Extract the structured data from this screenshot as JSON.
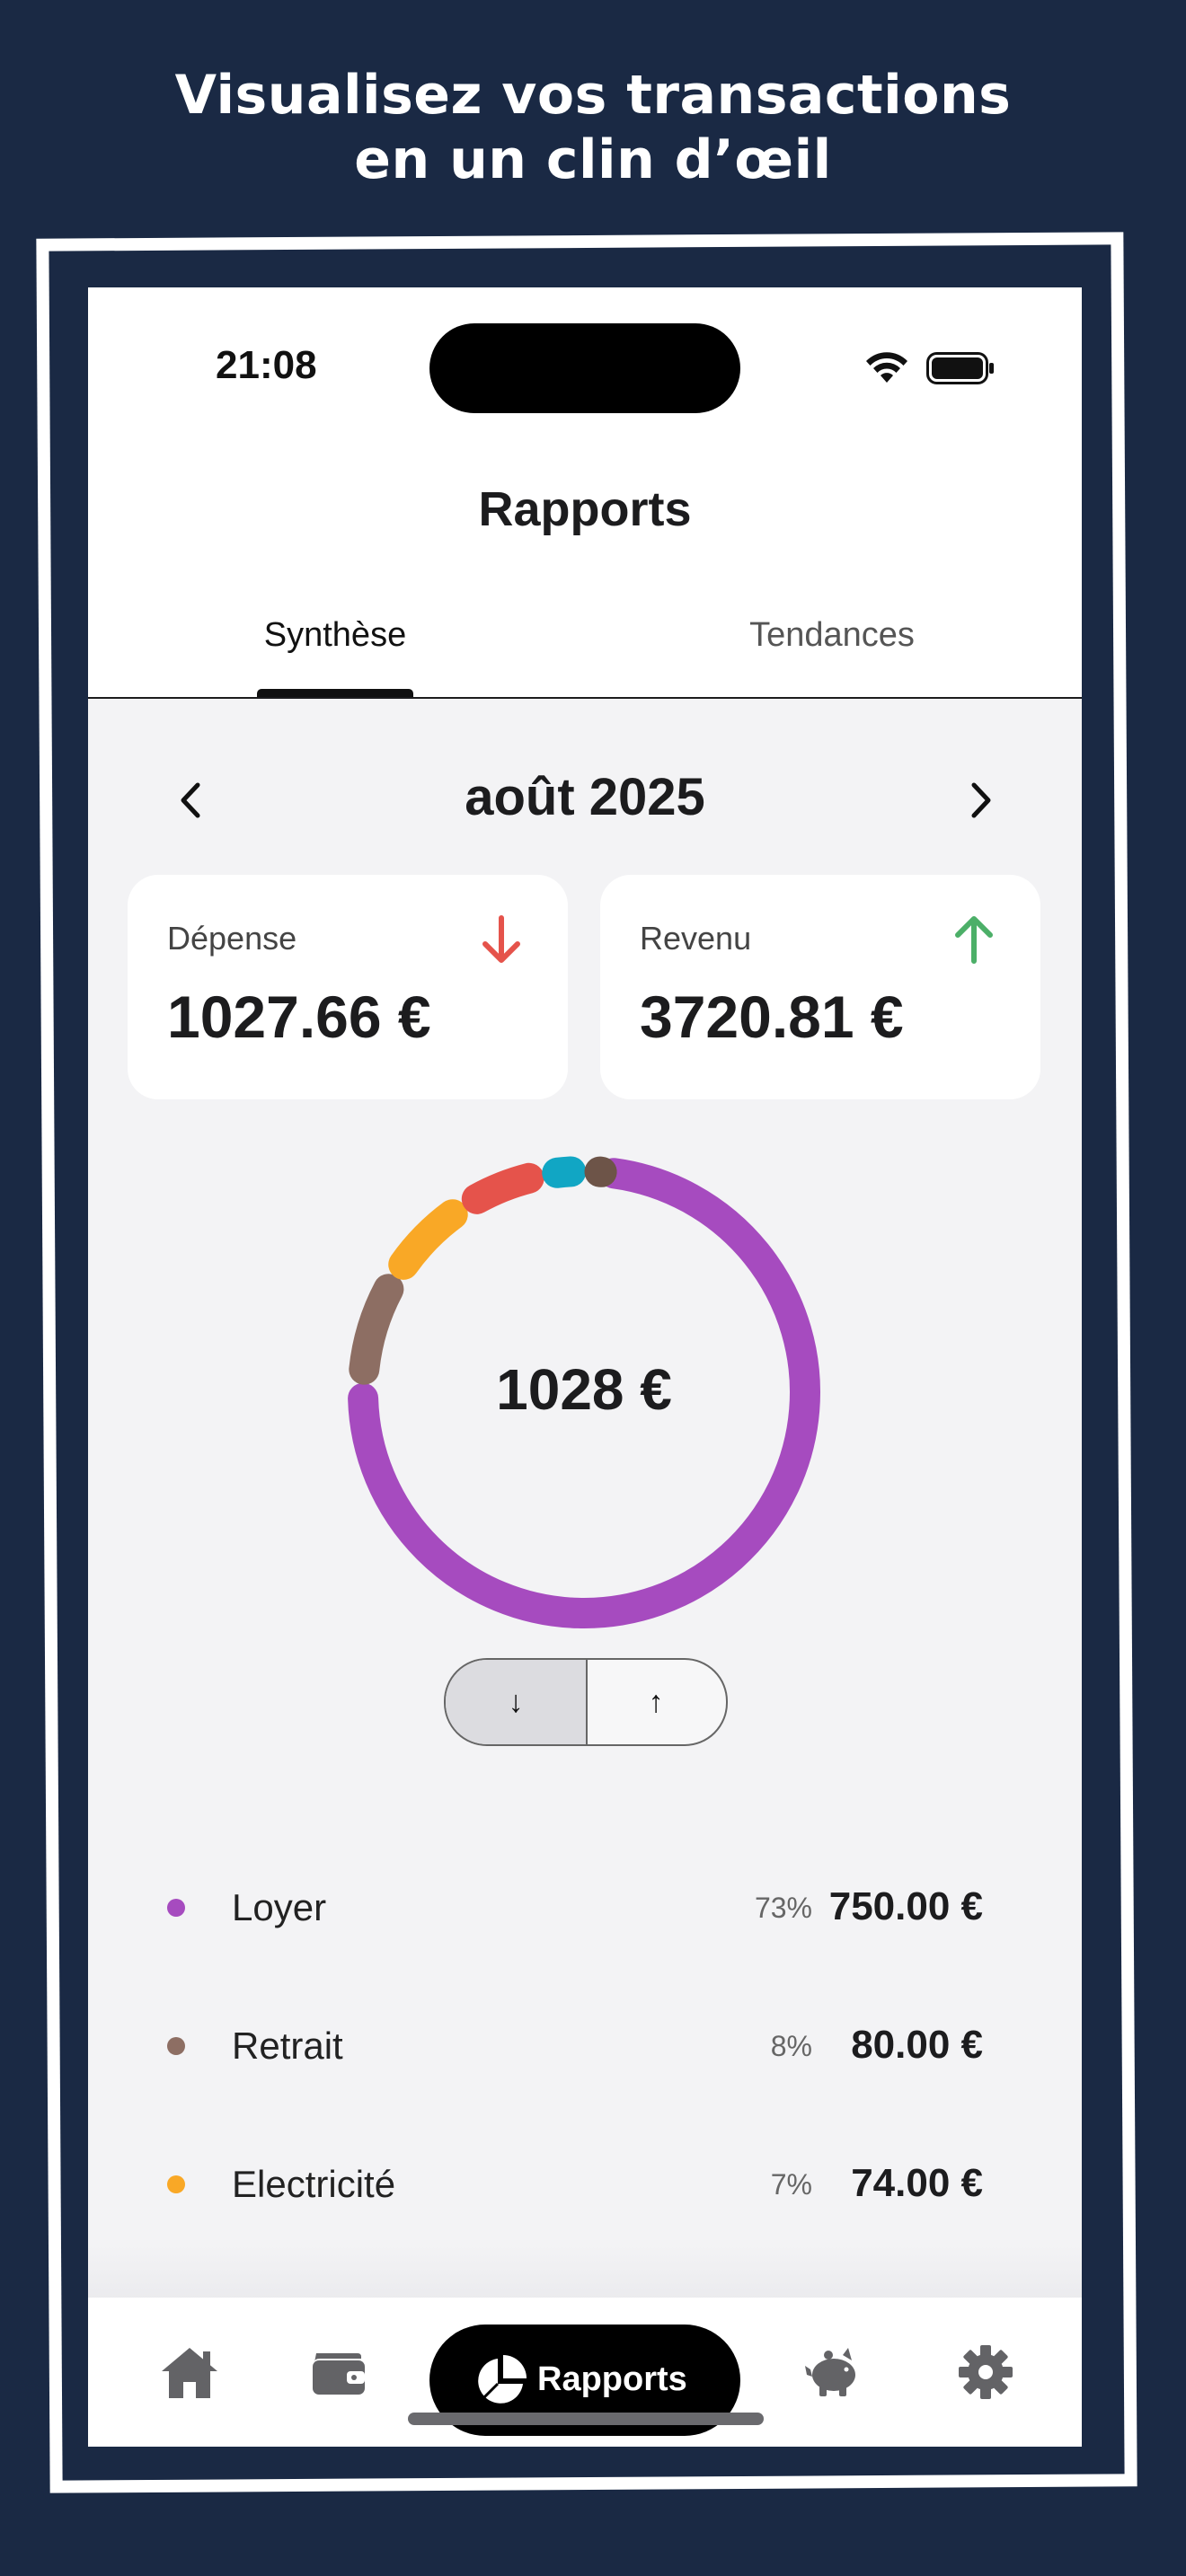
{
  "promo": {
    "line1": "Visualisez vos transactions",
    "line2": "en un clin d’œil"
  },
  "status_bar": {
    "time": "21:08",
    "icons": [
      "wifi-icon",
      "battery-icon"
    ]
  },
  "header": {
    "title": "Rapports"
  },
  "tabs": [
    {
      "label": "Synthèse",
      "active": true
    },
    {
      "label": "Tendances",
      "active": false
    }
  ],
  "period": {
    "label": "août 2025"
  },
  "summary": {
    "expense": {
      "label": "Dépense",
      "value": "1027.66 €",
      "icon": "arrow-down-icon",
      "color": "#e5534b"
    },
    "income": {
      "label": "Revenu",
      "value": "3720.81 €",
      "icon": "arrow-up-icon",
      "color": "#4caf68"
    }
  },
  "donut": {
    "center_label": "1028 €",
    "segments": [
      {
        "name": "Loyer",
        "percent": 73,
        "color": "#a64bbf"
      },
      {
        "name": "Retrait",
        "percent": 8,
        "color": "#8d6e63"
      },
      {
        "name": "Electricité",
        "percent": 7,
        "color": "#f9a826"
      },
      {
        "name": "segment-4",
        "percent": 6,
        "color": "#e5534b"
      },
      {
        "name": "segment-5",
        "percent": 3,
        "color": "#11a6c4"
      },
      {
        "name": "segment-6",
        "percent": 1,
        "color": "#6d5448"
      }
    ]
  },
  "toggle": {
    "left_icon": "arrow-down-icon",
    "right_icon": "arrow-up-icon",
    "left_glyph": "↓",
    "right_glyph": "↑",
    "selected": "left"
  },
  "categories": [
    {
      "name": "Loyer",
      "percent": "73%",
      "amount": "750.00 €",
      "color": "#a64bbf"
    },
    {
      "name": "Retrait",
      "percent": "8%",
      "amount": "80.00 €",
      "color": "#8d6e63"
    },
    {
      "name": "Electricité",
      "percent": "7%",
      "amount": "74.00 €",
      "color": "#f9a826"
    }
  ],
  "tab_bar": {
    "items": [
      "home-icon",
      "wallet-icon",
      "reports-icon",
      "piggy-bank-icon",
      "gear-icon"
    ],
    "active_label": "Rapports"
  }
}
